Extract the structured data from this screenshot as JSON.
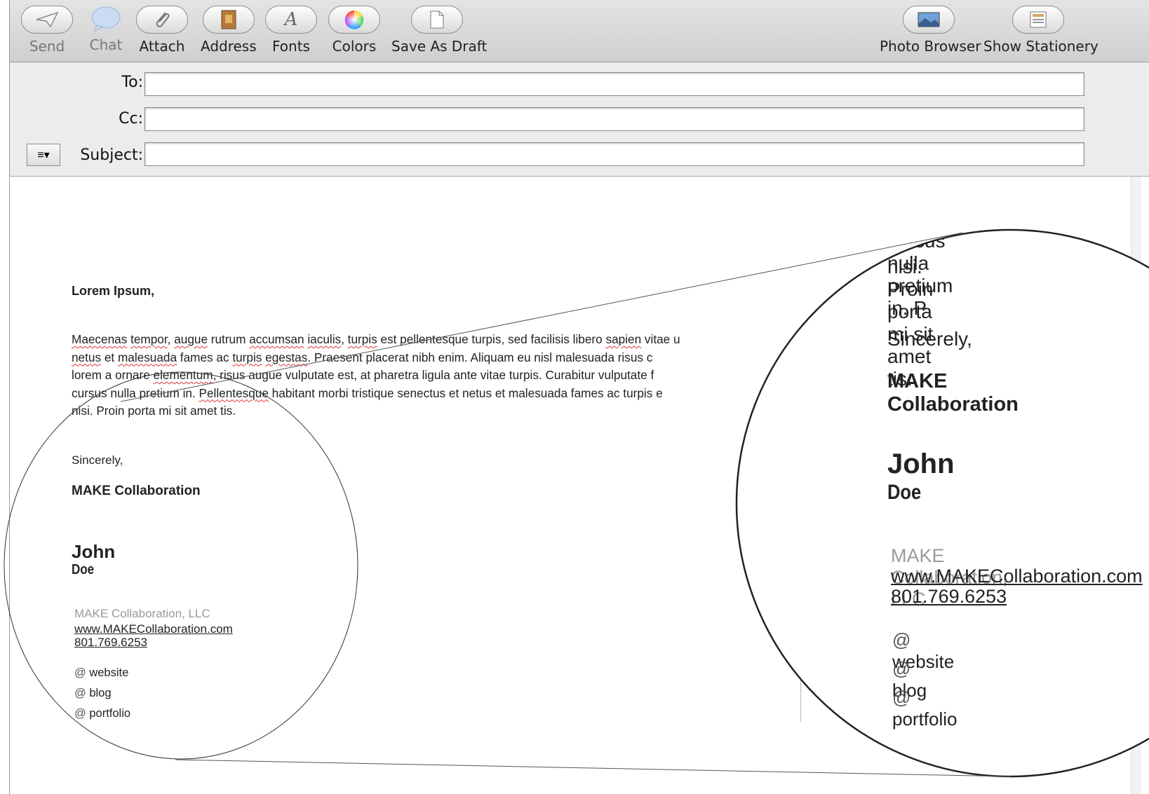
{
  "toolbar": {
    "buttons": [
      {
        "label": "Send",
        "icon": "send-icon"
      },
      {
        "label": "Chat",
        "icon": "chat-icon"
      },
      {
        "label": "Attach",
        "icon": "paperclip-icon"
      },
      {
        "label": "Address",
        "icon": "address-book-icon"
      },
      {
        "label": "Fonts",
        "icon": "fonts-icon"
      },
      {
        "label": "Colors",
        "icon": "color-wheel-icon"
      },
      {
        "label": "Save As Draft",
        "icon": "draft-icon"
      },
      {
        "label": "Photo Browser",
        "icon": "photo-icon"
      },
      {
        "label": "Show Stationery",
        "icon": "stationery-icon"
      }
    ]
  },
  "header": {
    "to_label": "To:",
    "to_value": "",
    "cc_label": "Cc:",
    "cc_value": "",
    "subject_label": "Subject:",
    "subject_value": "",
    "format_menu_glyph": "≡▾"
  },
  "message": {
    "greeting": "Lorem Ipsum,",
    "lines": [
      "Maecenas tempor, augue rutrum accumsan iaculis, turpis est pellentesque turpis, sed facilisis libero sapien vitae u",
      "netus et malesuada fames ac turpis egestas. Praesent placerat nibh enim. Aliquam eu nisl malesuada risus c",
      "lorem a ornare elementum, risus augue vulputate est, at pharetra ligula ante vitae turpis. Curabitur vulputate f",
      "cursus nulla pretium in. Pellentesque habitant morbi tristique senectus et netus et malesuada fames ac turpis e",
      "nisi. Proin porta mi sit amet tis."
    ],
    "closing": "Sincerely,",
    "company_bold": "MAKE Collaboration",
    "first_name": "John",
    "last_name": "Doe",
    "company_llc": "MAKE Collaboration, LLC",
    "website_url": "www.MAKECollaboration.com",
    "phone": "801.769.6253",
    "links": [
      {
        "at": "@",
        "label": "website"
      },
      {
        "at": "@",
        "label": "blog"
      },
      {
        "at": "@",
        "label": "portfolio"
      }
    ]
  },
  "magnified": {
    "line1": "cursus nulla pretium in. P",
    "line2": "nisi. Proin porta mi sit amet tis."
  }
}
